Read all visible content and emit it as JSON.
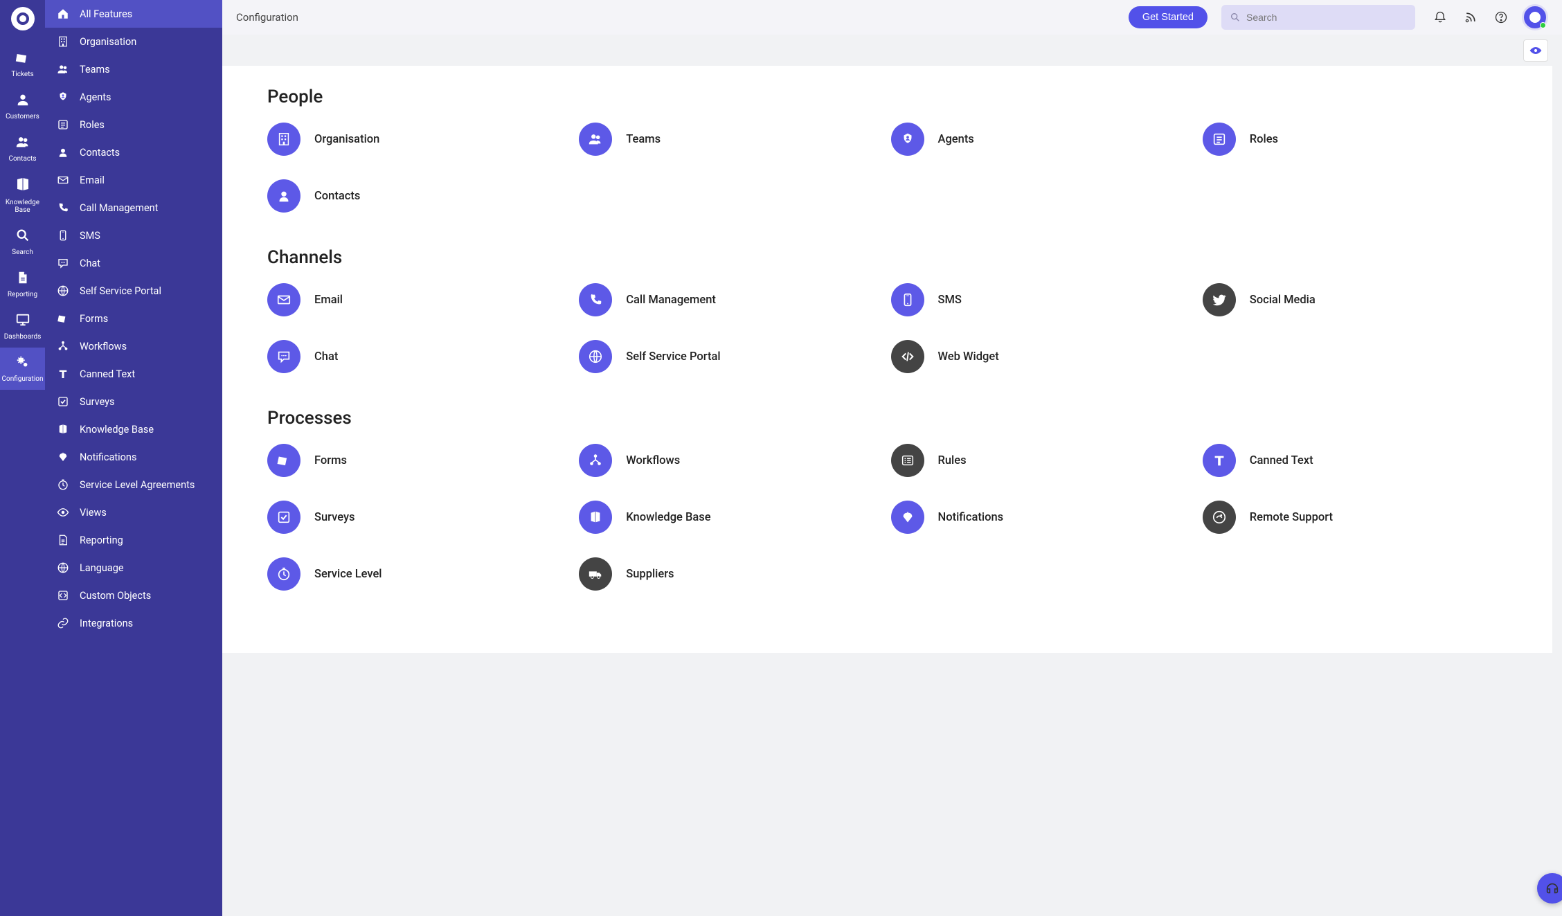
{
  "primaryNav": [
    {
      "label": "Tickets",
      "icon": "ticket"
    },
    {
      "label": "Customers",
      "icon": "user"
    },
    {
      "label": "Contacts",
      "icon": "users"
    },
    {
      "label": "Knowledge Base",
      "icon": "book"
    },
    {
      "label": "Search",
      "icon": "search"
    },
    {
      "label": "Reporting",
      "icon": "file"
    },
    {
      "label": "Dashboards",
      "icon": "monitor"
    },
    {
      "label": "Configuration",
      "icon": "gears",
      "active": true
    }
  ],
  "secondaryNav": [
    {
      "label": "All Features",
      "icon": "home",
      "active": true
    },
    {
      "label": "Organisation",
      "icon": "building"
    },
    {
      "label": "Teams",
      "icon": "users"
    },
    {
      "label": "Agents",
      "icon": "agent"
    },
    {
      "label": "Roles",
      "icon": "roles"
    },
    {
      "label": "Contacts",
      "icon": "contact"
    },
    {
      "label": "Email",
      "icon": "mail"
    },
    {
      "label": "Call Management",
      "icon": "phone"
    },
    {
      "label": "SMS",
      "icon": "sms"
    },
    {
      "label": "Chat",
      "icon": "chat"
    },
    {
      "label": "Self Service Portal",
      "icon": "globe"
    },
    {
      "label": "Forms",
      "icon": "forms"
    },
    {
      "label": "Workflows",
      "icon": "workflow"
    },
    {
      "label": "Canned Text",
      "icon": "text"
    },
    {
      "label": "Surveys",
      "icon": "check"
    },
    {
      "label": "Knowledge Base",
      "icon": "kb"
    },
    {
      "label": "Notifications",
      "icon": "notify"
    },
    {
      "label": "Service Level Agreements",
      "icon": "sla"
    },
    {
      "label": "Views",
      "icon": "eye"
    },
    {
      "label": "Reporting",
      "icon": "report"
    },
    {
      "label": "Language",
      "icon": "globe"
    },
    {
      "label": "Custom Objects",
      "icon": "custom"
    },
    {
      "label": "Integrations",
      "icon": "link"
    }
  ],
  "header": {
    "title": "Configuration",
    "getStarted": "Get Started",
    "searchPlaceholder": "Search"
  },
  "sections": [
    {
      "title": "People",
      "items": [
        {
          "label": "Organisation",
          "icon": "building",
          "color": "purple"
        },
        {
          "label": "Teams",
          "icon": "users",
          "color": "purple"
        },
        {
          "label": "Agents",
          "icon": "agent",
          "color": "purple"
        },
        {
          "label": "Roles",
          "icon": "roles",
          "color": "purple"
        },
        {
          "label": "Contacts",
          "icon": "contact",
          "color": "purple"
        }
      ]
    },
    {
      "title": "Channels",
      "items": [
        {
          "label": "Email",
          "icon": "mail",
          "color": "purple"
        },
        {
          "label": "Call Management",
          "icon": "phone",
          "color": "purple"
        },
        {
          "label": "SMS",
          "icon": "sms",
          "color": "purple"
        },
        {
          "label": "Social Media",
          "icon": "twitter",
          "color": "dark"
        },
        {
          "label": "Chat",
          "icon": "chat",
          "color": "purple"
        },
        {
          "label": "Self Service Portal",
          "icon": "globe",
          "color": "purple"
        },
        {
          "label": "Web Widget",
          "icon": "code",
          "color": "dark"
        }
      ]
    },
    {
      "title": "Processes",
      "items": [
        {
          "label": "Forms",
          "icon": "forms",
          "color": "purple"
        },
        {
          "label": "Workflows",
          "icon": "workflow",
          "color": "purple"
        },
        {
          "label": "Rules",
          "icon": "list",
          "color": "dark"
        },
        {
          "label": "Canned Text",
          "icon": "text",
          "color": "purple"
        },
        {
          "label": "Surveys",
          "icon": "check",
          "color": "purple"
        },
        {
          "label": "Knowledge Base",
          "icon": "kb",
          "color": "purple"
        },
        {
          "label": "Notifications",
          "icon": "notify",
          "color": "purple"
        },
        {
          "label": "Remote Support",
          "icon": "remote",
          "color": "dark"
        },
        {
          "label": "Service Level",
          "icon": "sla",
          "color": "purple"
        },
        {
          "label": "Suppliers",
          "icon": "truck",
          "color": "dark"
        }
      ]
    }
  ]
}
